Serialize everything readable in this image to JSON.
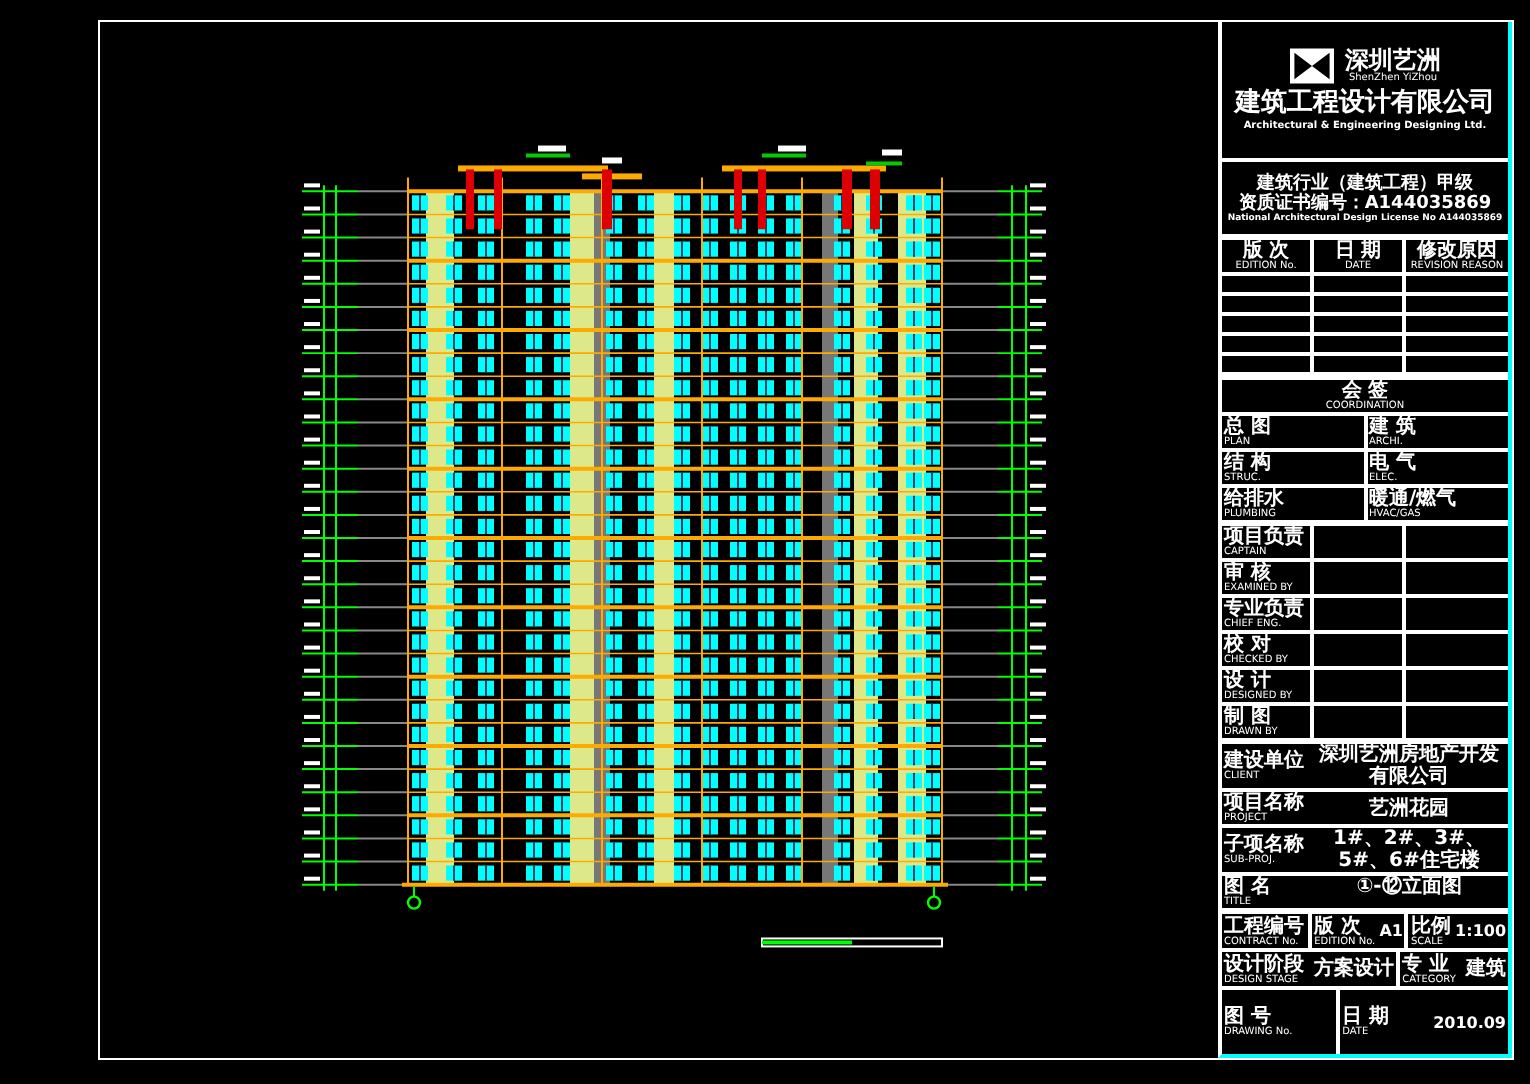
{
  "company": {
    "short_name": "深圳艺洲",
    "short_name_en": "ShenZhen YiZhou",
    "name": "建筑工程设计有限公司",
    "name_en": "Architectural & Engineering Designing Ltd."
  },
  "license": [
    "建筑行业（建筑工程）甲级",
    "资质证书编号：A144035869",
    "National Architectural Design License No A144035869"
  ],
  "revision_table": {
    "columns": [
      {
        "label": "版 次",
        "sublabel": "EDITION No."
      },
      {
        "label": "日 期",
        "sublabel": "DATE"
      },
      {
        "label": "修改原因",
        "sublabel": "REVISION REASON"
      }
    ]
  },
  "coordination": {
    "label": "会 签",
    "sublabel": "COORDINATION",
    "fields": [
      {
        "label": "总 图",
        "sublabel": "PLAN"
      },
      {
        "label": "建 筑",
        "sublabel": "ARCHI."
      },
      {
        "label": "结 构",
        "sublabel": "STRUC."
      },
      {
        "label": "电 气",
        "sublabel": "ELEC."
      },
      {
        "label": "给排水",
        "sublabel": "PLUMBING"
      },
      {
        "label": "暖通/燃气",
        "sublabel": "HVAC/GAS"
      }
    ]
  },
  "signatures": [
    {
      "label": "项目负责",
      "sublabel": "CAPTAIN"
    },
    {
      "label": "审 核",
      "sublabel": "EXAMINED BY"
    },
    {
      "label": "专业负责",
      "sublabel": "CHIEF ENG."
    },
    {
      "label": "校 对",
      "sublabel": "CHECKED BY"
    },
    {
      "label": "设 计",
      "sublabel": "DESIGNED BY"
    },
    {
      "label": "制 图",
      "sublabel": "DRAWN BY"
    }
  ],
  "project_info": [
    {
      "label": "建设单位",
      "sublabel": "CLIENT",
      "value": "深圳艺洲房地产开发有限公司"
    },
    {
      "label": "项目名称",
      "sublabel": "PROJECT",
      "value": "艺洲花园"
    },
    {
      "label": "子项名称",
      "sublabel": "SUB-PROJ.",
      "value": "1#、2#、3#、5#、6#住宅楼"
    },
    {
      "label": "图 名",
      "sublabel": "TITLE",
      "value": "①-⑫立面图"
    }
  ],
  "footer": [
    [
      {
        "label": "工程编号",
        "sublabel": "CONTRACT No."
      },
      {
        "label": "版 次",
        "sublabel": "EDITION No.",
        "value": "A1"
      },
      {
        "label": "比例",
        "sublabel": "SCALE",
        "value": "1:100"
      }
    ],
    [
      {
        "label": "设计阶段",
        "sublabel": "DESIGN STAGE",
        "value": "方案设计"
      },
      {
        "label": "专 业",
        "sublabel": "CATEGORY",
        "value": "建筑"
      }
    ],
    [
      {
        "label": "图 号",
        "sublabel": "DRAWING No."
      },
      {
        "label": "日 期",
        "sublabel": "DATE",
        "value": "2010.09"
      }
    ]
  ]
}
